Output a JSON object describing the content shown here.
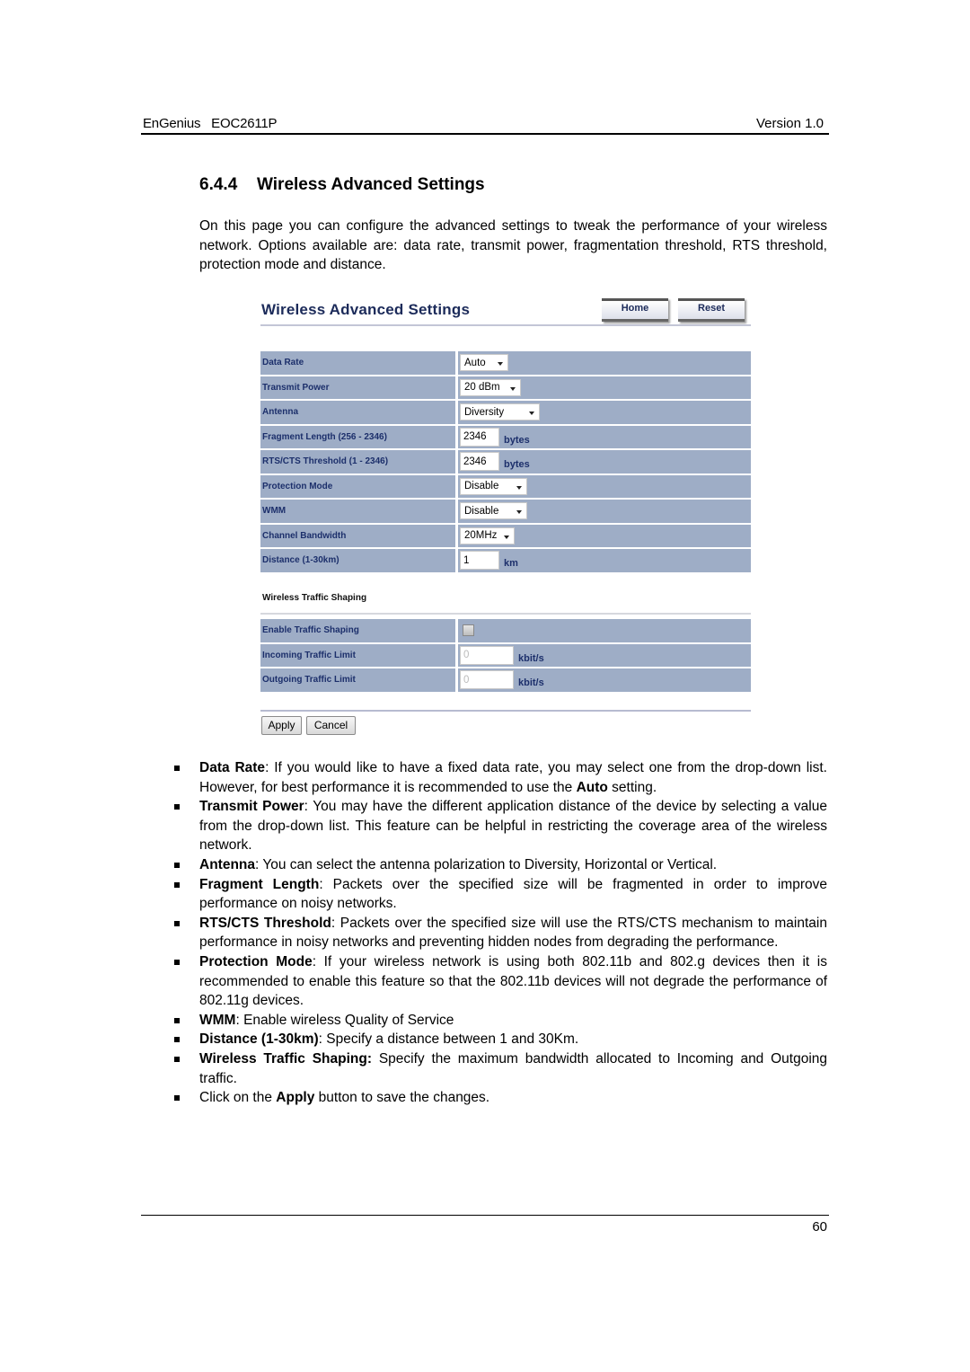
{
  "header": {
    "left": "EnGenius   EOC2611P",
    "right": "Version 1.0"
  },
  "section": {
    "number": "6.4.4",
    "title": "Wireless Advanced Settings"
  },
  "intro": "On this page you can configure the advanced settings to tweak the performance of your wireless network. Options available are: data rate, transmit power, fragmentation threshold, RTS threshold, protection mode and distance.",
  "panel": {
    "title": "Wireless Advanced Settings",
    "home_label": "Home",
    "reset_label": "Reset",
    "settings": [
      {
        "label": "Data Rate",
        "type": "select",
        "value": "Auto"
      },
      {
        "label": "Transmit Power",
        "type": "select",
        "value": "20 dBm"
      },
      {
        "label": "Antenna",
        "type": "select",
        "value": "Diversity"
      },
      {
        "label": "Fragment Length (256 - 2346)",
        "type": "text",
        "value": "2346",
        "unit": "bytes"
      },
      {
        "label": "RTS/CTS Threshold (1 - 2346)",
        "type": "text",
        "value": "2346",
        "unit": "bytes"
      },
      {
        "label": "Protection Mode",
        "type": "select",
        "value": "Disable"
      },
      {
        "label": "WMM",
        "type": "select",
        "value": "Disable"
      },
      {
        "label": "Channel Bandwidth",
        "type": "select",
        "value": "20MHz"
      },
      {
        "label": "Distance (1-30km)",
        "type": "text",
        "value": "1",
        "unit": "km"
      }
    ],
    "traffic_heading": "Wireless Traffic Shaping",
    "traffic": [
      {
        "label": "Enable Traffic Shaping",
        "type": "checkbox",
        "checked": false
      },
      {
        "label": "Incoming Traffic Limit",
        "type": "text",
        "value": "0",
        "unit": "kbit/s"
      },
      {
        "label": "Outgoing Traffic Limit",
        "type": "text",
        "value": "0",
        "unit": "kbit/s"
      }
    ],
    "apply_label": "Apply",
    "cancel_label": "Cancel"
  },
  "bullets": [
    {
      "term": "Data Rate",
      "pre": "",
      "text": ": If you would like to have a fixed data rate, you may select one from the drop-down list. However, for best performance it is recommended to use the ",
      "bold2": "Auto",
      "text2": " setting."
    },
    {
      "term": "Transmit Power",
      "pre": "",
      "text": ": You may have the different application distance of the device by selecting a value from the drop-down list. This feature can be helpful in restricting the coverage area of the wireless network.",
      "bold2": "",
      "text2": ""
    },
    {
      "term": "Antenna",
      "pre": "",
      "text": ": You can select the antenna polarization to Diversity, Horizontal or Vertical.",
      "bold2": "",
      "text2": ""
    },
    {
      "term": "Fragment Length",
      "pre": "",
      "text": ": Packets over the specified size will be fragmented in order to improve performance on noisy networks.",
      "bold2": "",
      "text2": ""
    },
    {
      "term": "RTS/CTS Threshold",
      "pre": "",
      "text": ": Packets over the specified size will use the RTS/CTS mechanism to maintain performance in noisy networks and preventing hidden nodes from degrading the performance.",
      "bold2": "",
      "text2": ""
    },
    {
      "term": "Protection Mode",
      "pre": "",
      "text": ": If your wireless network is using both 802.11b and 802.g devices then it is recommended to enable this feature so that the 802.11b devices will not degrade the performance of 802.11g devices.",
      "bold2": "",
      "text2": ""
    },
    {
      "term": "WMM",
      "pre": "",
      "text": ": Enable wireless Quality of Service",
      "bold2": "",
      "text2": ""
    },
    {
      "term": "Distance (1-30km)",
      "pre": "",
      "text": ": Specify a distance between 1 and 30Km.",
      "bold2": "",
      "text2": ""
    },
    {
      "term": "Wireless Traffic Shaping:",
      "pre": "",
      "text": " Specify the maximum bandwidth allocated to Incoming and Outgoing traffic.",
      "bold2": "",
      "text2": ""
    },
    {
      "term": "Apply",
      "pre": "Click on the ",
      "text": " button to save the changes.",
      "bold2": "",
      "text2": ""
    }
  ],
  "footer": {
    "page_number": "60"
  }
}
